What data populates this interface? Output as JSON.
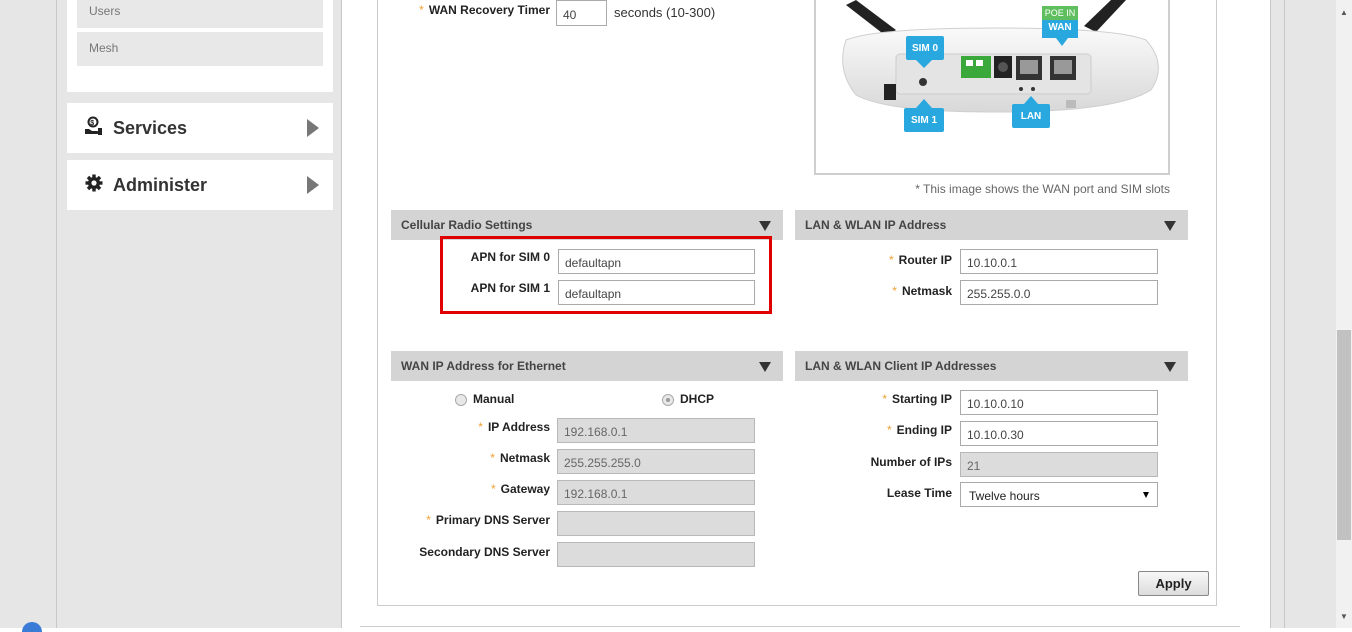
{
  "sidebar": {
    "submenu": [
      "Users",
      "Mesh"
    ],
    "services_label": "Services",
    "administer_label": "Administer"
  },
  "wan_recovery": {
    "label": "WAN Recovery Timer",
    "value": "40",
    "hint": "seconds (10-300)"
  },
  "device_image": {
    "labels": {
      "sim0": "SIM 0",
      "sim1": "SIM 1",
      "poe_in": "POE IN",
      "wan": "WAN",
      "lan": "LAN"
    },
    "caption": "* This image shows the WAN port and SIM slots"
  },
  "cellular": {
    "header": "Cellular Radio Settings",
    "apn_sim0_label": "APN for SIM 0",
    "apn_sim0_value": "defaultapn",
    "apn_sim1_label": "APN for SIM 1",
    "apn_sim1_value": "defaultapn"
  },
  "lan_wlan_ip": {
    "header": "LAN & WLAN IP Address",
    "router_ip_label": "Router IP",
    "router_ip_value": "10.10.0.1",
    "netmask_label": "Netmask",
    "netmask_value": "255.255.0.0"
  },
  "wan_eth": {
    "header": "WAN IP Address for Ethernet",
    "manual_label": "Manual",
    "dhcp_label": "DHCP",
    "selected_mode": "DHCP",
    "ip_label": "IP Address",
    "ip_value": "192.168.0.1",
    "netmask_label": "Netmask",
    "netmask_value": "255.255.255.0",
    "gateway_label": "Gateway",
    "gateway_value": "192.168.0.1",
    "primary_dns_label": "Primary DNS Server",
    "primary_dns_value": "",
    "secondary_dns_label": "Secondary DNS Server",
    "secondary_dns_value": ""
  },
  "client_ips": {
    "header": "LAN & WLAN Client IP Addresses",
    "starting_ip_label": "Starting IP",
    "starting_ip_value": "10.10.0.10",
    "ending_ip_label": "Ending IP",
    "ending_ip_value": "10.10.0.30",
    "num_ips_label": "Number of IPs",
    "num_ips_value": "21",
    "lease_time_label": "Lease Time",
    "lease_time_value": "Twelve hours"
  },
  "apply_label": "Apply",
  "colors": {
    "accent_blue": "#29a8e0",
    "poe_green": "#4caf50",
    "highlight_red": "#e00000",
    "required_orange": "#f0a030"
  }
}
